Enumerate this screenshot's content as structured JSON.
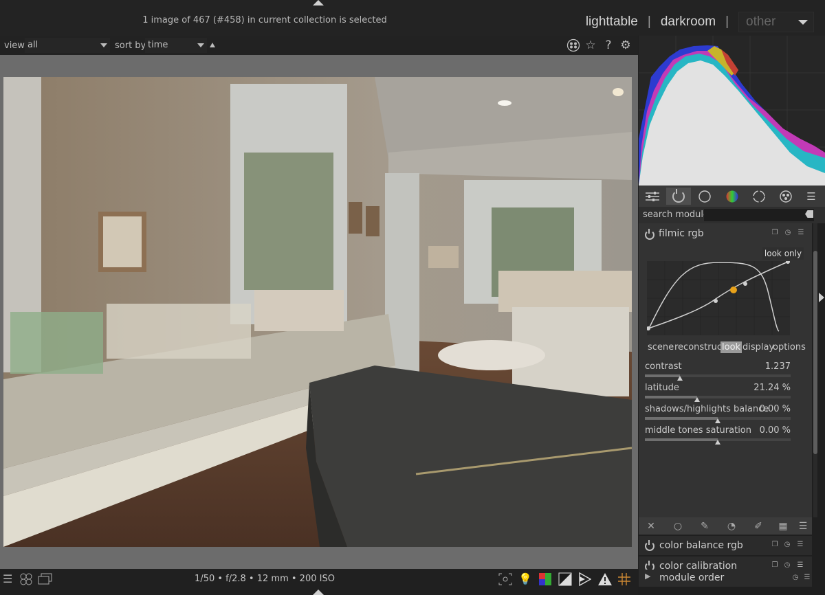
{
  "status": "1 image of 467 (#458) in current collection is selected",
  "views": {
    "lighttable": "lighttable",
    "darkroom": "darkroom",
    "other": "other",
    "separator": "|"
  },
  "filter": {
    "view_label": "view",
    "view_value": "all",
    "sort_label": "sort by",
    "sort_value": "time"
  },
  "top_icons": [
    "grouping-icon",
    "star-icon",
    "help-icon",
    "gear-icon"
  ],
  "module_groups": [
    "quick-access-icon",
    "active-modules-icon",
    "base-group-icon",
    "color-group-icon",
    "correct-group-icon",
    "effects-group-icon",
    "presets-menu-icon"
  ],
  "search": {
    "label": "search module",
    "value": ""
  },
  "module": {
    "name": "filmic rgb",
    "badge": "look only",
    "tabs": [
      "scene",
      "reconstruct",
      "look",
      "display",
      "options"
    ],
    "active_tab": "look",
    "sliders": [
      {
        "label": "contrast",
        "value": "1.237",
        "level": 0.24
      },
      {
        "label": "latitude",
        "value": "21.24 %",
        "level": 0.36
      },
      {
        "label": "shadows/highlights balance",
        "value": "0.00 %",
        "level": 0.5
      },
      {
        "label": "middle tones saturation",
        "value": "0.00 %",
        "level": 0.5
      }
    ]
  },
  "tool_icons": [
    "reset-icon",
    "mask-off-icon",
    "drawn-mask-icon",
    "parametric-mask-icon",
    "drawn-parametric-mask-icon",
    "raster-mask-icon",
    "menu-icon"
  ],
  "collapsed_modules": [
    {
      "name": "color balance rgb"
    },
    {
      "name": "color calibration"
    }
  ],
  "module_order": "module order",
  "exif": "1/50 • f/2.8 • 12 mm • 200 ISO",
  "colors": {
    "accent_orange": "#e8a21a",
    "panel": "#333333",
    "background": "#1f1f1f"
  }
}
